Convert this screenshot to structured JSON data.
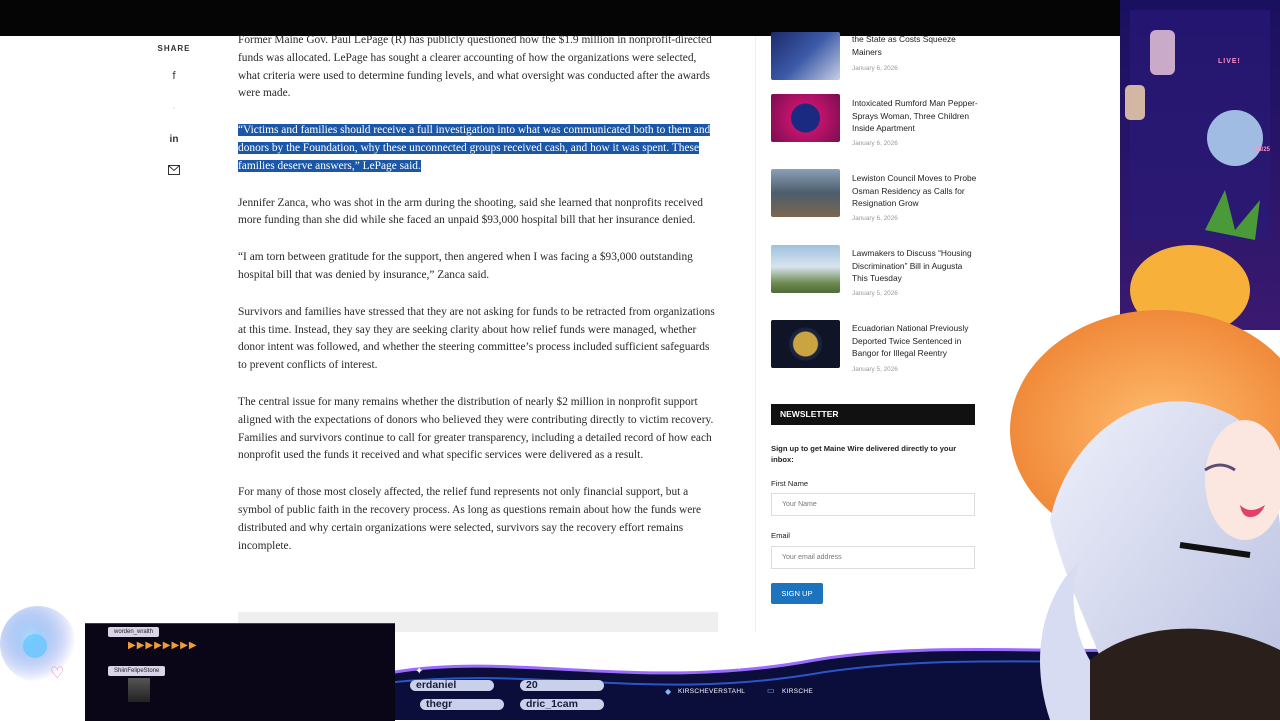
{
  "share": {
    "label": "SHARE"
  },
  "article": {
    "p1": "Former Maine Gov. Paul LePage (R) has publicly questioned how the $1.9 million in nonprofit-directed funds was allocated. LePage has sought a clearer accounting of how the organizations were selected, what criteria were used to determine funding levels, and what oversight was conducted after the awards were made.",
    "p2": "“Victims and families should receive a full investigation into what was communicated both to them and donors by the Foundation, why these unconnected groups received cash, and how it was spent. These families deserve answers,” LePage said.",
    "p3": "Jennifer Zanca, who was shot in the arm during the shooting, said she learned that nonprofits received more funding than she did while she faced an unpaid $93,000 hospital bill that her insurance denied.",
    "p4": "“I am torn between gratitude for the support, then angered when I was facing a $93,000 outstanding hospital bill that was denied by insurance,” Zanca said.",
    "p5": "Survivors and families have stressed that they are not asking for funds to be retracted from organizations at this time. Instead, they say they are seeking clarity about how relief funds were managed, whether donor intent was followed, and whether the steering committee’s process included sufficient safeguards to prevent conflicts of interest.",
    "p6": "The central issue for many remains whether the distribution of nearly $2 million in nonprofit support aligned with the expectations of donors who believed they were contributing directly to victim recovery. Families and survivors continue to call for greater transparency, including a detailed record of how each nonprofit used the funds it received and what specific services were delivered as a result.",
    "p7": "For many of those most closely affected, the relief fund represents not only financial support, but a symbol of public faith in the recovery process. As long as questions remain about how the funds were distributed and why certain organizations were selected, survivors say the recovery effort remains incomplete."
  },
  "sidebar": {
    "posts": [
      {
        "title": "the State as Costs Squeeze Mainers",
        "date": "January 6, 2026"
      },
      {
        "title": "Intoxicated Rumford Man Pepper-Sprays Woman, Three Children Inside Apartment",
        "date": "January 6, 2026"
      },
      {
        "title": "Lewiston Council Moves to Probe Osman Residency as Calls for Resignation Grow",
        "date": "January 6, 2026"
      },
      {
        "title": "Lawmakers to Discuss “Housing Discrimination” Bill in Augusta This Tuesday",
        "date": "January 5, 2026"
      },
      {
        "title": "Ecuadorian National Previously Deported Twice Sentenced in Bangor for Illegal Reentry",
        "date": "January 5, 2026"
      }
    ]
  },
  "newsletter": {
    "heading": "NEWSLETTER",
    "desc": "Sign up to get Maine Wire delivered directly to your inbox:",
    "first_name_label": "First Name",
    "first_name_placeholder": "Your Name",
    "email_label": "Email",
    "email_placeholder": "Your email address",
    "signup_label": "SIGN UP"
  },
  "overlay": {
    "chat_names": [
      "worden_wralth",
      "ShiinFelipeStone"
    ],
    "arrows": "▶▶▶▶▶▶▶▶",
    "ticker": [
      "erdaniel",
      "20",
      "thegr",
      "dric_1cam"
    ],
    "socials": [
      "KIRSCHEVERSTAHL",
      "KIRSCHE"
    ],
    "live": "LIVE!",
    "counter": "58/25"
  },
  "colors": {
    "highlight": "#1b57a8",
    "signup": "#1e73be",
    "overlay_dark": "#0b0d3a"
  }
}
